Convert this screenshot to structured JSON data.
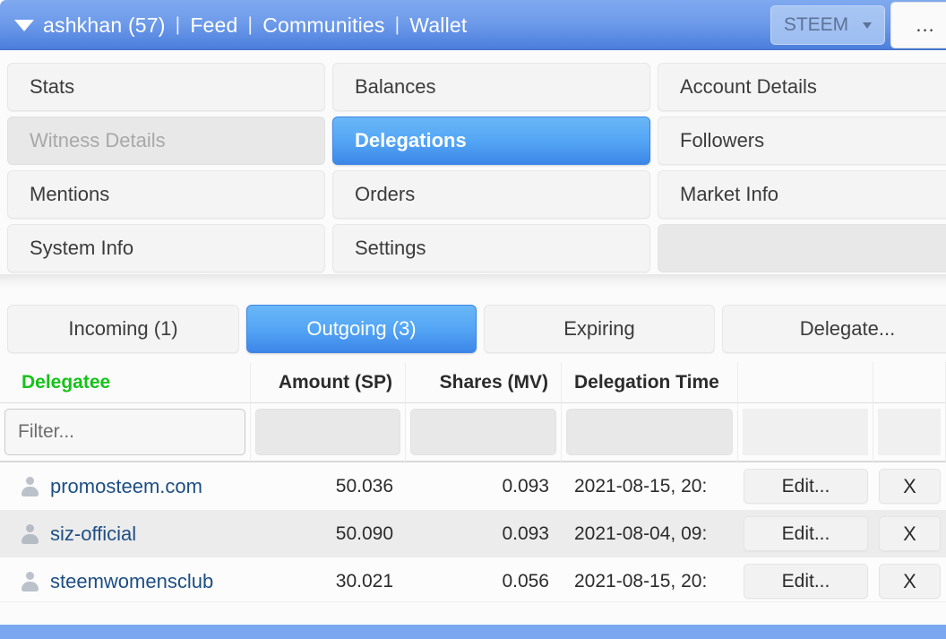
{
  "header": {
    "caret_icon": "caret-down-icon",
    "username": "ashkhan (57)",
    "separator": "|",
    "links": [
      "Feed",
      "Communities",
      "Wallet"
    ],
    "currency_select": {
      "value": "STEEM",
      "caret_icon": "chevron-down-icon"
    },
    "more_button": "...",
    "brand_color": "#4a7ddc"
  },
  "tabs": [
    {
      "label": "Stats",
      "state": "normal"
    },
    {
      "label": "Balances",
      "state": "normal"
    },
    {
      "label": "Account Details",
      "state": "normal"
    },
    {
      "label": "Witness Details",
      "state": "disabled"
    },
    {
      "label": "Delegations",
      "state": "active"
    },
    {
      "label": "Followers",
      "state": "normal"
    },
    {
      "label": "Mentions",
      "state": "normal"
    },
    {
      "label": "Orders",
      "state": "normal"
    },
    {
      "label": "Market Info",
      "state": "normal"
    },
    {
      "label": "System Info",
      "state": "normal"
    },
    {
      "label": "Settings",
      "state": "normal"
    },
    {
      "label": "",
      "state": "empty"
    }
  ],
  "subtabs": [
    {
      "label": "Incoming (1)",
      "state": "normal"
    },
    {
      "label": "Outgoing (3)",
      "state": "active"
    },
    {
      "label": "Expiring",
      "state": "normal"
    },
    {
      "label": "Delegate...",
      "state": "normal"
    }
  ],
  "table": {
    "columns": [
      {
        "label": "Delegatee",
        "sorted": true,
        "align": "left"
      },
      {
        "label": "Amount (SP)",
        "sorted": false,
        "align": "right"
      },
      {
        "label": "Shares (MV)",
        "sorted": false,
        "align": "right"
      },
      {
        "label": "Delegation Time",
        "sorted": false,
        "align": "left"
      },
      {
        "label": "",
        "sorted": false,
        "align": "center"
      },
      {
        "label": "",
        "sorted": false,
        "align": "center"
      }
    ],
    "filter": {
      "placeholder": "Filter...",
      "value": ""
    },
    "sorted_column_color": "#16c219",
    "rows": [
      {
        "icon": "person-icon",
        "delegatee": "promosteem.com",
        "amount_sp": "50.036",
        "shares_mv": "0.093",
        "delegation_time": "2021-08-15, 20:",
        "edit_label": "Edit...",
        "remove_label": "X"
      },
      {
        "icon": "person-icon",
        "delegatee": "siz-official",
        "amount_sp": "50.090",
        "shares_mv": "0.093",
        "delegation_time": "2021-08-04, 09:",
        "edit_label": "Edit...",
        "remove_label": "X"
      },
      {
        "icon": "person-icon",
        "delegatee": "steemwomensclub",
        "amount_sp": "30.021",
        "shares_mv": "0.056",
        "delegation_time": "2021-08-15, 20:",
        "edit_label": "Edit...",
        "remove_label": "X"
      }
    ]
  }
}
